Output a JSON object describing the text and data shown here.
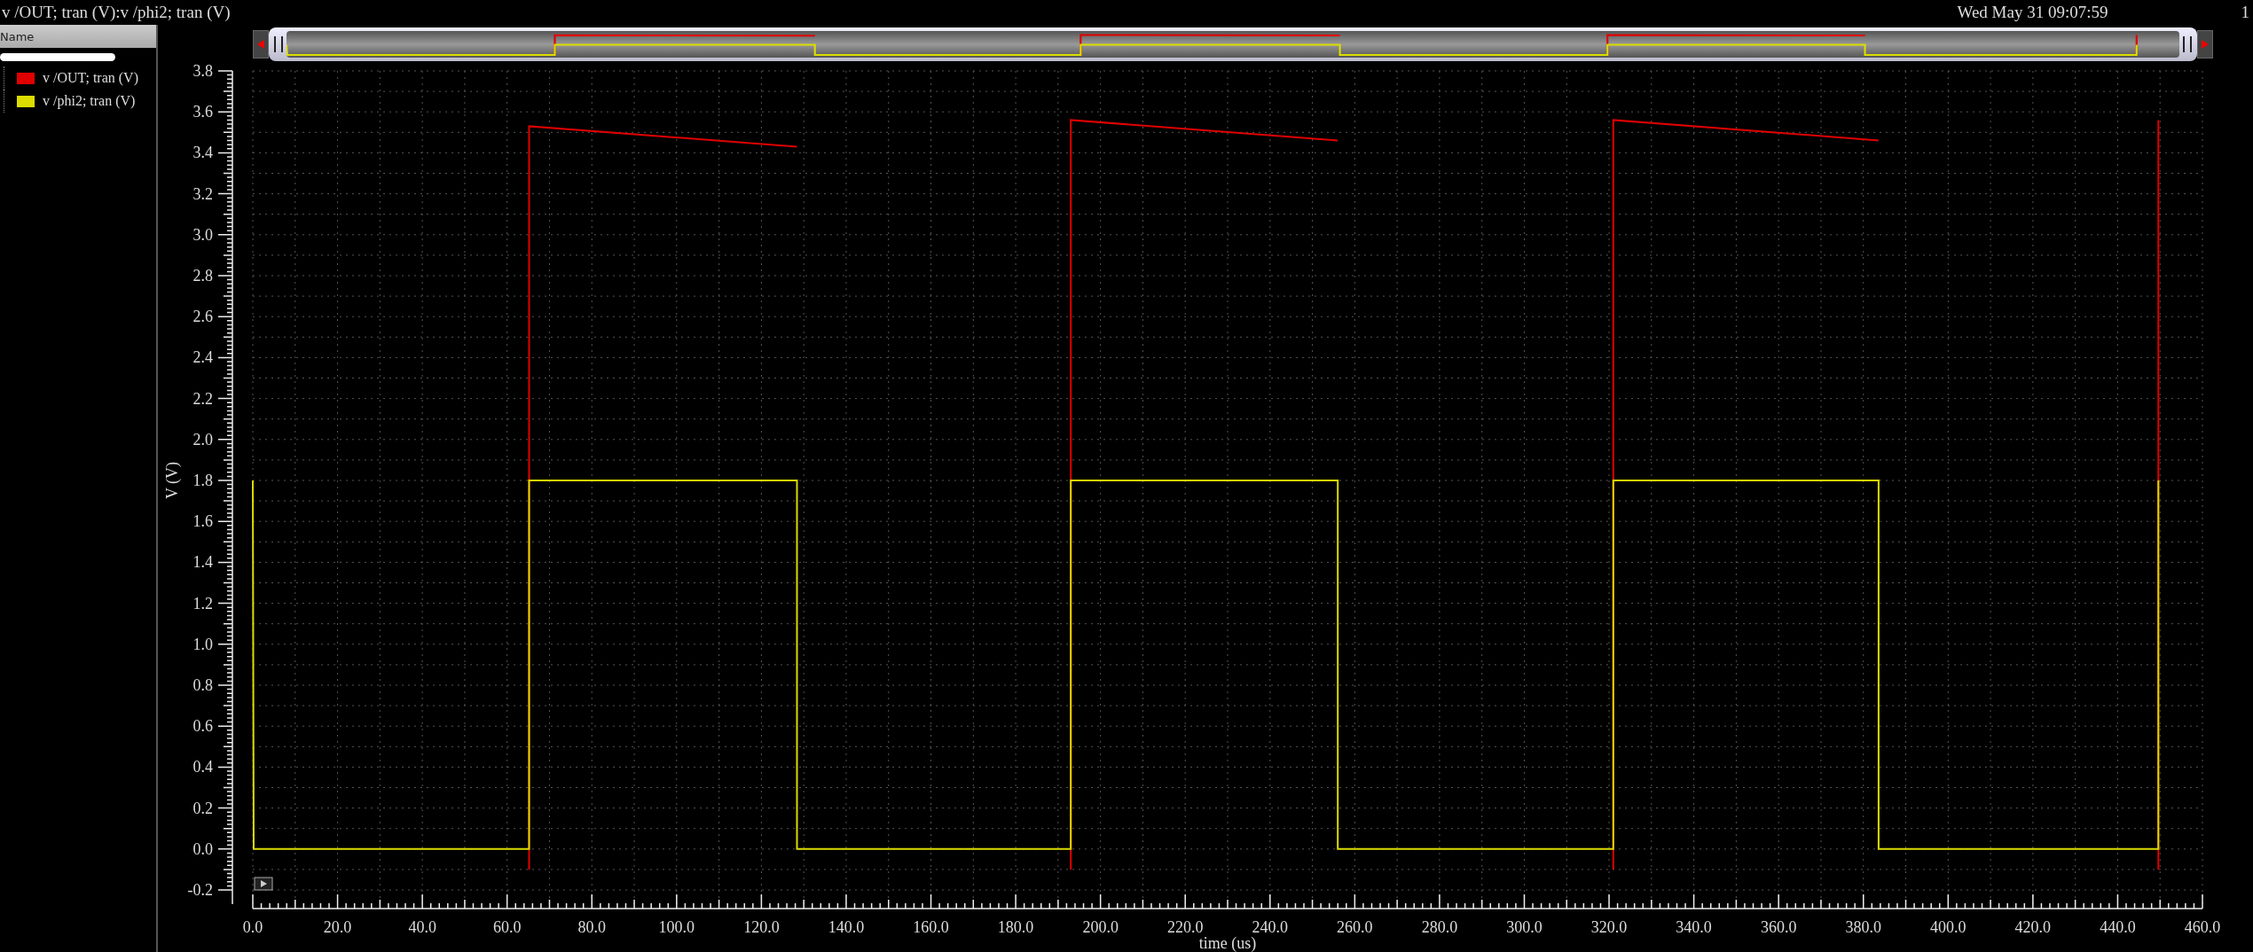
{
  "window": {
    "title": "v /OUT; tran (V):v /phi2; tran (V)",
    "timestamp": "Wed May 31 09:07:59",
    "edge_fragment": "1"
  },
  "legend": {
    "header": "Name"
  },
  "plot": {
    "chart_data": {
      "type": "line",
      "xlabel": "time (us)",
      "ylabel": "V (V)",
      "grid": true,
      "x": [
        0,
        0.2,
        65.2,
        65.2,
        128.4,
        128.4,
        193,
        193,
        256,
        256,
        321,
        321,
        383.6,
        383.6,
        449.6,
        449.6
      ],
      "series": [
        {
          "name": "v /OUT; tran (V)",
          "color": "#e00000",
          "values": [
            null,
            null,
            -0.1,
            3.53,
            3.43,
            null,
            -0.1,
            3.56,
            3.46,
            null,
            -0.1,
            3.56,
            3.46,
            null,
            -0.1,
            3.56
          ]
        },
        {
          "name": "v /phi2; tran (V)",
          "color": "#dcdc00",
          "values": [
            1.8,
            0,
            0,
            1.8,
            1.8,
            0,
            0,
            1.8,
            1.8,
            0,
            0,
            1.8,
            1.8,
            0,
            0,
            1.8
          ]
        }
      ],
      "xlim": [
        0,
        460
      ],
      "ylim": [
        -0.2,
        3.8
      ],
      "xticks": [
        {
          "value": 0,
          "label": "0.0"
        },
        {
          "value": 20,
          "label": "20.0"
        },
        {
          "value": 40,
          "label": "40.0"
        },
        {
          "value": 60,
          "label": "60.0"
        },
        {
          "value": 80,
          "label": "80.0"
        },
        {
          "value": 100,
          "label": "100.0"
        },
        {
          "value": 120,
          "label": "120.0"
        },
        {
          "value": 140,
          "label": "140.0"
        },
        {
          "value": 160,
          "label": "160.0"
        },
        {
          "value": 180,
          "label": "180.0"
        },
        {
          "value": 200,
          "label": "200.0"
        },
        {
          "value": 220,
          "label": "220.0"
        },
        {
          "value": 240,
          "label": "240.0"
        },
        {
          "value": 260,
          "label": "260.0"
        },
        {
          "value": 280,
          "label": "280.0"
        },
        {
          "value": 300,
          "label": "300.0"
        },
        {
          "value": 320,
          "label": "320.0"
        },
        {
          "value": 340,
          "label": "340.0"
        },
        {
          "value": 360,
          "label": "360.0"
        },
        {
          "value": 380,
          "label": "380.0"
        },
        {
          "value": 400,
          "label": "400.0"
        },
        {
          "value": 420,
          "label": "420.0"
        },
        {
          "value": 440,
          "label": "440.0"
        },
        {
          "value": 460,
          "label": "460.0"
        }
      ],
      "yticks": [
        {
          "value": -0.2,
          "label": "-0.2"
        },
        {
          "value": 0,
          "label": "0.0"
        },
        {
          "value": 0.2,
          "label": "0.2"
        },
        {
          "value": 0.4,
          "label": "0.4"
        },
        {
          "value": 0.6,
          "label": "0.6"
        },
        {
          "value": 0.8,
          "label": "0.8"
        },
        {
          "value": 1.0,
          "label": "1.0"
        },
        {
          "value": 1.2,
          "label": "1.2"
        },
        {
          "value": 1.4,
          "label": "1.4"
        },
        {
          "value": 1.6,
          "label": "1.6"
        },
        {
          "value": 1.8,
          "label": "1.8"
        },
        {
          "value": 2.0,
          "label": "2.0"
        },
        {
          "value": 2.2,
          "label": "2.2"
        },
        {
          "value": 2.4,
          "label": "2.4"
        },
        {
          "value": 2.6,
          "label": "2.6"
        },
        {
          "value": 2.8,
          "label": "2.8"
        },
        {
          "value": 3.0,
          "label": "3.0"
        },
        {
          "value": 3.2,
          "label": "3.2"
        },
        {
          "value": 3.4,
          "label": "3.4"
        },
        {
          "value": 3.6,
          "label": "3.6"
        },
        {
          "value": 3.8,
          "label": "3.8"
        }
      ]
    }
  }
}
